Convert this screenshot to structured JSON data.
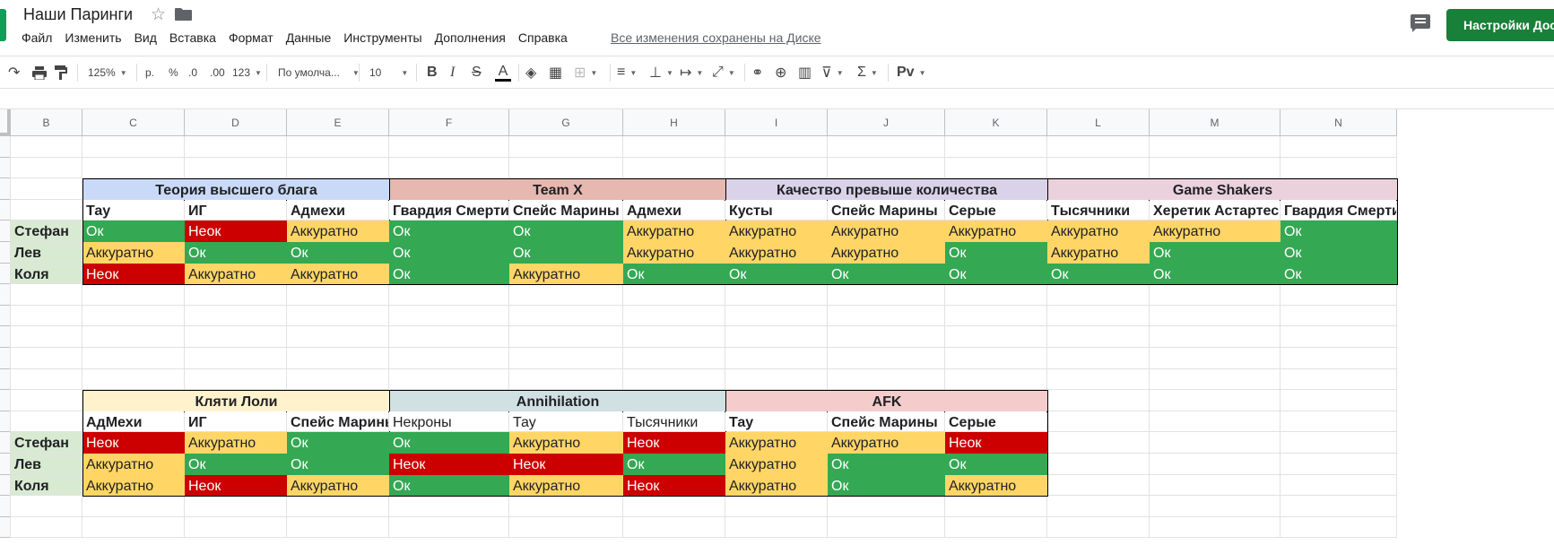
{
  "app": {
    "title": "Наши Паринги",
    "save_status": "Все изменения сохранены на Диске",
    "share_label": "Настройки Доступа",
    "colors": {
      "brand_green": "#188038",
      "ok": "#34a853",
      "neok": "#cc0000",
      "akk": "#ffd666"
    },
    "icons": [
      "star-icon",
      "folder-icon",
      "comments-icon",
      "lock-icon"
    ]
  },
  "menu": {
    "items": [
      "Файл",
      "Изменить",
      "Вид",
      "Вставка",
      "Формат",
      "Данные",
      "Инструменты",
      "Дополнения",
      "Справка"
    ]
  },
  "toolbar": {
    "zoom": "125%",
    "currency": "р.",
    "percent": "%",
    "dec_less": ".0",
    "dec_more": ".00",
    "more_formats": "123",
    "font": "По умолча...",
    "font_size": "10",
    "bold": "B",
    "italic": "I",
    "strike": "S",
    "text_color": "A",
    "input_tools": "Рv"
  },
  "columns": [
    "B",
    "C",
    "D",
    "E",
    "F",
    "G",
    "H",
    "I",
    "J",
    "K",
    "L",
    "M",
    "N"
  ],
  "ratings": {
    "ok": "Ок",
    "neok": "Неок",
    "akk": "Аккуратно"
  },
  "players": [
    "Стефан",
    "Лев",
    "Коля"
  ],
  "table_top": {
    "teams": [
      {
        "name": "Теория высшего блага",
        "armies": [
          "Тау",
          "ИГ",
          "Адмехи"
        ],
        "results": [
          [
            "Ок",
            "Неок",
            "Аккуратно"
          ],
          [
            "Аккуратно",
            "Ок",
            "Ок"
          ],
          [
            "Неок",
            "Аккуратно",
            "Аккуратно"
          ]
        ]
      },
      {
        "name": "Team X",
        "armies": [
          "Гвардия Смерти",
          "Спейс Марины",
          "Адмехи"
        ],
        "results": [
          [
            "Ок",
            "Ок",
            "Аккуратно"
          ],
          [
            "Ок",
            "Ок",
            "Аккуратно"
          ],
          [
            "Ок",
            "Аккуратно",
            "Ок"
          ]
        ]
      },
      {
        "name": "Качество превыше количества",
        "armies": [
          "Кусты",
          "Спейс Марины",
          "Серые"
        ],
        "results": [
          [
            "Аккуратно",
            "Аккуратно",
            "Аккуратно"
          ],
          [
            "Аккуратно",
            "Аккуратно",
            "Ок"
          ],
          [
            "Ок",
            "Ок",
            "Ок"
          ]
        ]
      },
      {
        "name": "Game Shakers",
        "armies": [
          "Тысячники",
          "Херетик Астартес",
          "Гвардия Смерти"
        ],
        "results": [
          [
            "Аккуратно",
            "Аккуратно",
            "Ок"
          ],
          [
            "Аккуратно",
            "Ок",
            "Ок"
          ],
          [
            "Ок",
            "Ок",
            "Ок"
          ]
        ]
      }
    ]
  },
  "table_bottom": {
    "teams": [
      {
        "name": "Кляти Лоли",
        "armies": [
          "АдМехи",
          "ИГ",
          "Спейс Марины"
        ],
        "results": [
          [
            "Неок",
            "Аккуратно",
            "Ок"
          ],
          [
            "Аккуратно",
            "Ок",
            "Ок"
          ],
          [
            "Аккуратно",
            "Неок",
            "Аккуратно"
          ]
        ]
      },
      {
        "name": "Annihilation",
        "armies": [
          "Некроны",
          "Тау",
          "Тысячники"
        ],
        "results": [
          [
            "Ок",
            "Аккуратно",
            "Неок"
          ],
          [
            "Неок",
            "Неок",
            "Ок"
          ],
          [
            "Ок",
            "Аккуратно",
            "Неок"
          ]
        ]
      },
      {
        "name": "AFK",
        "armies": [
          "Тау",
          "Спейс Марины",
          "Серые"
        ],
        "results": [
          [
            "Аккуратно",
            "Аккуратно",
            "Неок"
          ],
          [
            "Аккуратно",
            "Ок",
            "Ок"
          ],
          [
            "Аккуратно",
            "Ок",
            "Аккуратно"
          ]
        ]
      }
    ]
  }
}
